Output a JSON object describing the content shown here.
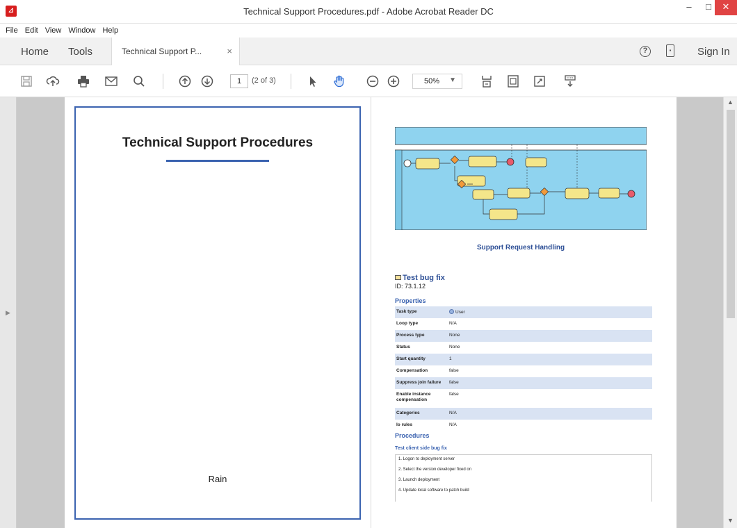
{
  "window": {
    "title": "Technical Support Procedures.pdf - Adobe Acrobat Reader DC",
    "app_icon": "pdf-icon",
    "min": "–",
    "max": "□",
    "close": "✕"
  },
  "menu": [
    "File",
    "Edit",
    "View",
    "Window",
    "Help"
  ],
  "tabs": {
    "home": "Home",
    "tools": "Tools",
    "document": "Technical Support P...",
    "close": "×",
    "help": "?",
    "sign_in": "Sign In"
  },
  "toolbar": {
    "page_current": "1",
    "page_of": "(2 of 3)",
    "zoom": "50%",
    "zoom_arrow": "▼"
  },
  "page1": {
    "title": "Technical Support Procedures",
    "author": "Rain"
  },
  "page2": {
    "diagram_caption": "Support Request Handling",
    "task_title": "Test bug fix",
    "task_id": "ID: 73.1.12",
    "properties_heading": "Properties",
    "properties": [
      {
        "key": "Task type",
        "value": "User"
      },
      {
        "key": "Loop type",
        "value": "N/A"
      },
      {
        "key": "Process type",
        "value": "None"
      },
      {
        "key": "Status",
        "value": "None"
      },
      {
        "key": "Start quantity",
        "value": "1"
      },
      {
        "key": "Compensation",
        "value": "false"
      },
      {
        "key": "Suppress join failure",
        "value": "false"
      },
      {
        "key": "Enable instance compensation",
        "value": "false"
      },
      {
        "key": "Categories",
        "value": "N/A"
      },
      {
        "key": "Io rules",
        "value": "N/A"
      }
    ],
    "procedures_heading": "Procedures",
    "procedure_name": "Test client side bug fix",
    "steps": [
      "1. Logon to deployment server",
      "2. Select the version developer fixed on",
      "3. Launch deployment",
      "4. Update local software to patch build"
    ]
  },
  "colors": {
    "accent_blue": "#3b63b0",
    "table_shade": "#d9e3f3",
    "close_red": "#e04343",
    "diagram_lane": "#8fd3ef",
    "task_yellow": "#f4e68a",
    "gateway_orange": "#f29a3a"
  }
}
